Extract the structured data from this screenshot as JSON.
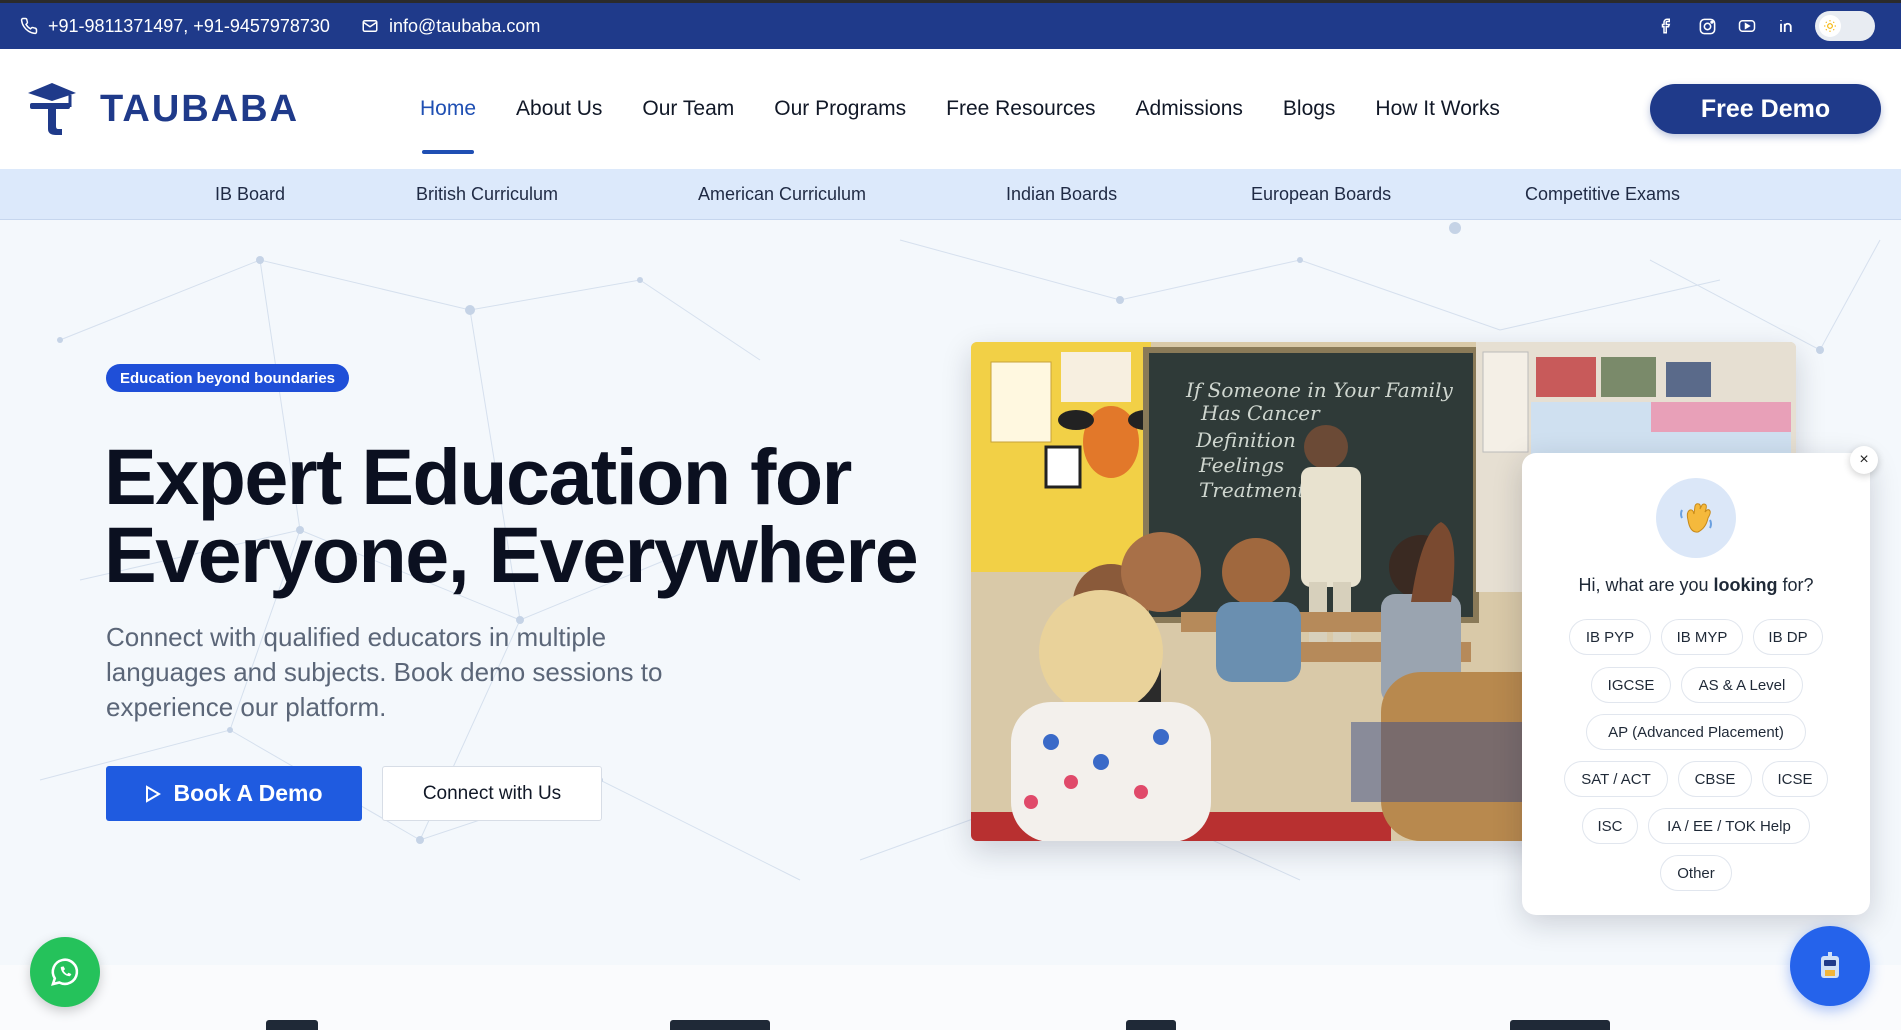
{
  "topbar": {
    "phone": "+91-9811371497, +91-9457978730",
    "email": "info@taubaba.com",
    "social_icons": [
      "facebook-icon",
      "instagram-icon",
      "youtube-icon",
      "linkedin-icon"
    ]
  },
  "header": {
    "logo_text": "TAUBABA",
    "nav": [
      {
        "label": "Home",
        "active": true
      },
      {
        "label": "About Us"
      },
      {
        "label": "Our Team"
      },
      {
        "label": "Our Programs"
      },
      {
        "label": "Free Resources"
      },
      {
        "label": "Admissions"
      },
      {
        "label": "Blogs"
      },
      {
        "label": "How It Works"
      }
    ],
    "demo_label": "Free Demo"
  },
  "subnav": [
    "IB Board",
    "British Curriculum",
    "American Curriculum",
    "Indian Boards",
    "European Boards",
    "Competitive Exams"
  ],
  "hero": {
    "badge": "Education beyond boundaries",
    "title_line1": "Expert Education for",
    "title_line2": "Everyone, Everywhere",
    "subtitle": "Connect with qualified educators in multiple languages and subjects. Book demo sessions to experience our platform.",
    "book_label": "Book A Demo",
    "connect_label": "Connect with Us",
    "chalkboard_lines": [
      "If Someone in Your Family",
      "Has Cancer",
      "Definition",
      "Feelings",
      "Treatment"
    ]
  },
  "chat": {
    "close": "×",
    "question_pre": "Hi, what are you ",
    "question_bold": "looking",
    "question_post": " for?",
    "chips": [
      "IB PYP",
      "IB MYP",
      "IB DP",
      "IGCSE",
      "AS & A Level",
      "AP (Advanced Placement)",
      "SAT / ACT",
      "CBSE",
      "ICSE",
      "ISC",
      "IA / EE / TOK Help",
      "Other"
    ]
  },
  "colors": {
    "brand": "#1f3a8a",
    "accent": "#1f5be0",
    "subnav_bg": "#dce9fb",
    "whatsapp": "#25c25b"
  }
}
